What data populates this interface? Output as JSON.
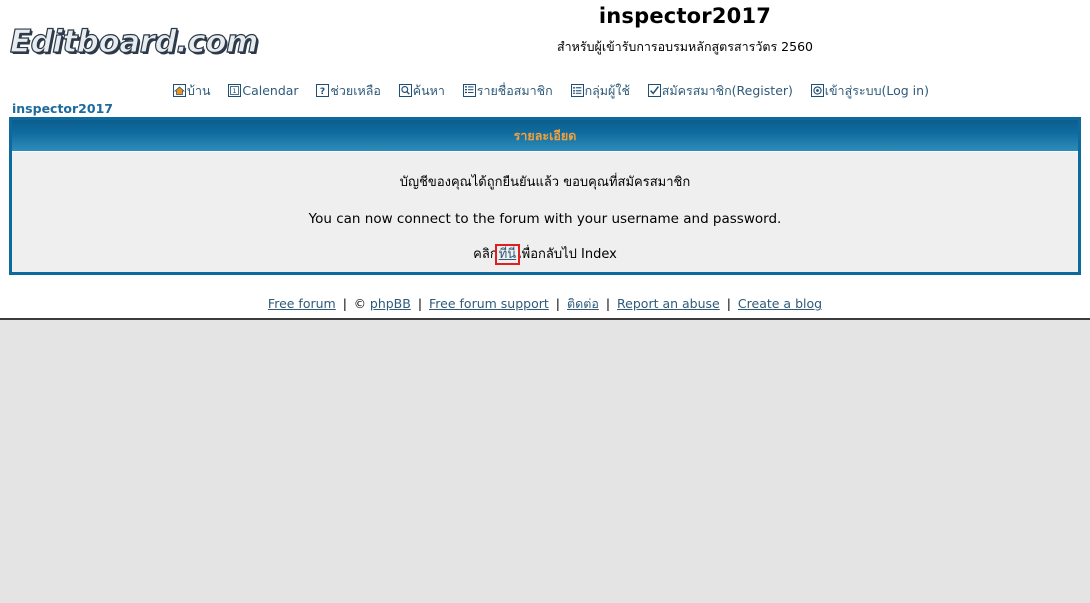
{
  "header": {
    "logo_text": "Editboard.com",
    "board_title": "inspector2017",
    "board_description": "สำหรับผู้เข้ารับการอบรมหลักสูตรสารวัตร 2560"
  },
  "nav": {
    "items": [
      {
        "label": "บ้าน",
        "icon": "home-icon"
      },
      {
        "label": "Calendar",
        "icon": "calendar-icon"
      },
      {
        "label": "ช่วยเหลือ",
        "icon": "help-question-icon"
      },
      {
        "label": "ค้นหา",
        "icon": "search-icon"
      },
      {
        "label": "รายชื่อสมาชิก",
        "icon": "memberlist-icon"
      },
      {
        "label": "กลุ่มผู้ใช้",
        "icon": "usergroups-icon"
      },
      {
        "label": "สมัครสมาชิก(Register)",
        "icon": "register-check-icon"
      },
      {
        "label": "เข้าสู่ระบบ(Log in)",
        "icon": "login-icon"
      }
    ]
  },
  "breadcrumb": {
    "label": "inspector2017"
  },
  "panel": {
    "title": "รายละเอียด",
    "message_thai": "บัญชีของคุณได้ถูกยืนยันแล้ว ขอบคุณที่สมัครสมาชิก",
    "message_english": "You can now connect to the forum with your username and password.",
    "return_prefix": "คลิก",
    "return_link": "ที่นี่",
    "return_suffix": "เพื่อกลับไป Index"
  },
  "footer": {
    "links": [
      {
        "label": "Free forum",
        "prefix": ""
      },
      {
        "label": "phpBB",
        "prefix": "©"
      },
      {
        "label": "Free forum support",
        "prefix": ""
      },
      {
        "label": "ติดต่อ",
        "prefix": ""
      },
      {
        "label": "Report an abuse",
        "prefix": ""
      },
      {
        "label": "Create a blog",
        "prefix": ""
      }
    ],
    "separator": "|"
  },
  "colors": {
    "panel_border": "#0d6a9d",
    "panel_head_top": "#0d5d8e",
    "panel_head_bottom": "#2e8cb8",
    "panel_title_text": "#f2a03c",
    "link": "#2f5a7a",
    "breadcrumb": "#1d6a9c",
    "page_background": "#e4e4e4",
    "panel_background": "#efefef",
    "highlight_outline": "#e02020"
  }
}
